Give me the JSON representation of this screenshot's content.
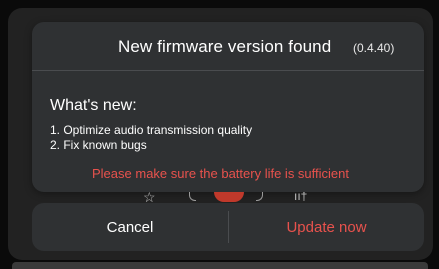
{
  "dialog": {
    "title": "New firmware version found",
    "version": "(0.4.40)",
    "whats_new_heading": "What's new:",
    "release_notes": [
      "1. Optimize audio transmission quality",
      "2. Fix known bugs"
    ],
    "warning": "Please make sure the battery life is sufficient"
  },
  "actions": {
    "cancel_label": "Cancel",
    "update_label": "Update now"
  },
  "colors": {
    "dialog_bg": "#2f3133",
    "warning": "#e8524d",
    "accent_action": "#e8524d",
    "text": "#ffffff"
  },
  "background_peek_icons": [
    "star-icon",
    "record-button-icon",
    "equalizer-icon"
  ]
}
